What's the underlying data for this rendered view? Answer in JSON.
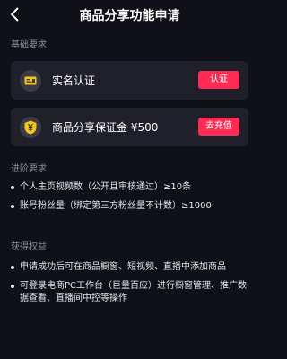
{
  "header": {
    "title": "商品分享功能申请"
  },
  "basic": {
    "title": "基础要求",
    "items": [
      {
        "label": "实名认证",
        "button": "认证",
        "icon": "id-card-icon"
      },
      {
        "label": "商品分享保证金 ¥500",
        "button": "去充值",
        "icon": "yuan-shield-icon"
      }
    ]
  },
  "advanced": {
    "title": "进阶要求",
    "items": [
      "个人主页视频数（公开且审核通过）≥10条",
      "账号粉丝量（绑定第三方粉丝量不计数）≥1000"
    ]
  },
  "benefits": {
    "title": "获得权益",
    "items": [
      "申请成功后可在商品橱窗、短视频、直播中添加商品",
      "可登录电商PC工作台（巨量百应）进行橱窗管理、推广数据查看、直播间中控等操作"
    ]
  },
  "colors": {
    "accent": "#fe2c55",
    "background": "#0f1018",
    "card": "#1f2029",
    "shield": "#f5c518"
  }
}
